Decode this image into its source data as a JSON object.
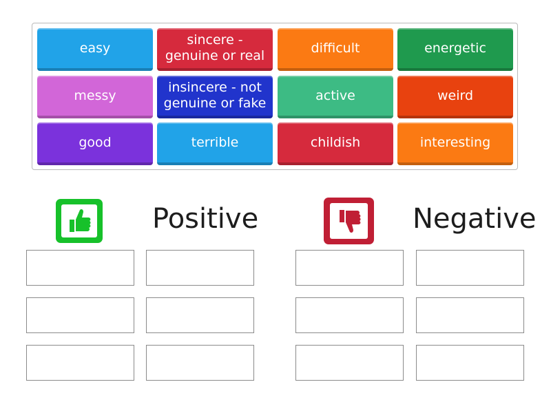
{
  "tiles": [
    {
      "label": "easy",
      "color": "#21a3e8"
    },
    {
      "label": "sincere - genuine or real",
      "color": "#d62a3d"
    },
    {
      "label": "difficult",
      "color": "#fb7a13"
    },
    {
      "label": "energetic",
      "color": "#1f9a4e"
    },
    {
      "label": "messy",
      "color": "#d266d8"
    },
    {
      "label": "insincere - not genuine or fake",
      "color": "#2134cc"
    },
    {
      "label": "active",
      "color": "#3dbb84"
    },
    {
      "label": "weird",
      "color": "#e8420f"
    },
    {
      "label": "good",
      "color": "#7b32dc"
    },
    {
      "label": "terrible",
      "color": "#21a3e8"
    },
    {
      "label": "childish",
      "color": "#d62a3d"
    },
    {
      "label": "interesting",
      "color": "#fb7a13"
    }
  ],
  "groups": [
    {
      "title": "Positive",
      "icon": "thumbs-up-icon",
      "color": "#17c12a"
    },
    {
      "title": "Negative",
      "icon": "thumbs-down-icon",
      "color": "#c01f35"
    }
  ]
}
